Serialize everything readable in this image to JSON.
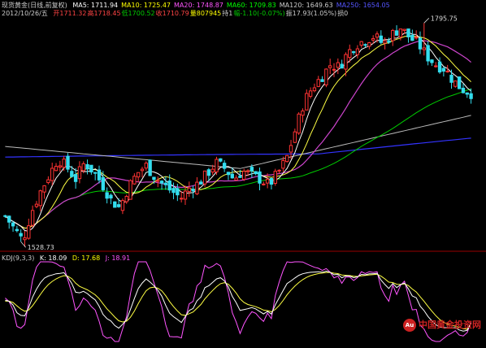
{
  "header": {
    "instrument": "现货黄金(日线,前复权)",
    "mas": [
      {
        "label": "MA5: 1711.94",
        "color": "#ffffff"
      },
      {
        "label": "MA10: 1725.47",
        "color": "#ffff00"
      },
      {
        "label": "MA20: 1748.87",
        "color": "#ff55ff"
      },
      {
        "label": "MA60: 1709.83",
        "color": "#00ff00"
      },
      {
        "label": "MA120: 1649.63",
        "color": "#cccccc"
      },
      {
        "label": "MA250: 1654.05",
        "color": "#5555ff"
      }
    ],
    "date": "2012/10/26/五",
    "ohlc": [
      {
        "label": "开",
        "value": "1711.32",
        "color": "#ff4444"
      },
      {
        "label": "高",
        "value": "1718.45",
        "color": "#ff4444"
      },
      {
        "label": "低",
        "value": "1700.52",
        "color": "#00cc00"
      },
      {
        "label": "收",
        "value": "1710.79",
        "color": "#ff4444"
      },
      {
        "label": "量",
        "value": "807945",
        "color": "#ffff00"
      },
      {
        "label": "持",
        "value": "1",
        "color": "#cccccc"
      },
      {
        "label": "幅",
        "value": "-1.10(-0.07%)",
        "color": "#00cc00"
      },
      {
        "label": "振",
        "value": "17.93(1.05%)",
        "color": "#cccccc"
      },
      {
        "label": "损",
        "value": "0",
        "color": "#cccccc"
      }
    ]
  },
  "kdj_header": {
    "name": "KDJ(9,3,3)",
    "k": "K: 18.09",
    "d": "D: 17.68",
    "j": "J: 18.91",
    "k_color": "#ffffff",
    "d_color": "#ffff00",
    "j_color": "#ff55ff"
  },
  "annotations": {
    "high_label": "1795.75",
    "low_label": "1528.73"
  },
  "watermark": {
    "logo": "Au",
    "text": "中国黄金投资网"
  },
  "colors": {
    "up": "#ff3333",
    "down": "#33ddee",
    "kline": "#ffffff",
    "dline": "#ffff44",
    "jline": "#ff55ff",
    "ma5": "#ffffff",
    "ma10": "#ffff44",
    "ma20": "#cc44cc",
    "ma60": "#00cc00",
    "ma120": "#bbbbbb",
    "ma250": "#3333ff",
    "grid": "#990000"
  },
  "chart_data": [
    {
      "type": "candlestick",
      "title": "现货黄金(日线,前复权)",
      "ylim": [
        1520,
        1800
      ],
      "x_count": 120,
      "anchor_prices": [
        1560,
        1545,
        1530,
        1565,
        1590,
        1610,
        1630,
        1620,
        1605,
        1625,
        1615,
        1600,
        1580,
        1570,
        1595,
        1612,
        1622,
        1608,
        1598,
        1590,
        1582,
        1595,
        1600,
        1612,
        1625,
        1618,
        1605,
        1615,
        1610,
        1605,
        1598,
        1612,
        1630,
        1665,
        1700,
        1718,
        1730,
        1745,
        1742,
        1760,
        1770,
        1775,
        1780,
        1770,
        1782,
        1790,
        1778,
        1770,
        1755,
        1745,
        1740,
        1725,
        1715,
        1710
      ],
      "series": [
        {
          "name": "MA5",
          "value": 1711.94
        },
        {
          "name": "MA10",
          "value": 1725.47
        },
        {
          "name": "MA20",
          "value": 1748.87
        },
        {
          "name": "MA60",
          "value": 1709.83
        },
        {
          "name": "MA120",
          "value": 1649.63
        },
        {
          "name": "MA250",
          "value": 1654.05
        }
      ],
      "annotations": [
        {
          "text": "1795.75",
          "x_index": 107,
          "y": 1795.75
        },
        {
          "text": "1528.73",
          "x_index": 4,
          "y": 1528.73
        }
      ]
    },
    {
      "type": "line",
      "title": "KDJ(9,3,3)",
      "ylim": [
        0,
        100
      ],
      "series": [
        {
          "name": "K",
          "last": 18.09
        },
        {
          "name": "D",
          "last": 17.68
        },
        {
          "name": "J",
          "last": 18.91
        }
      ]
    }
  ]
}
